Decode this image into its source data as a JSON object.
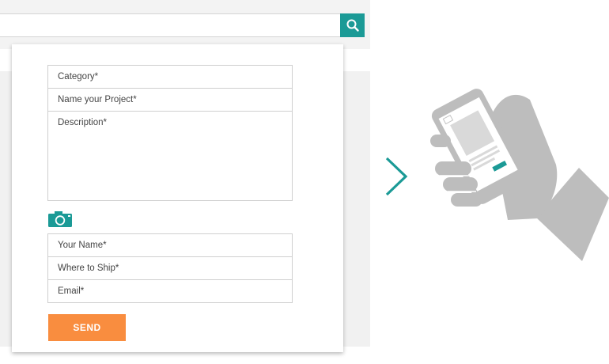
{
  "search": {
    "placeholder": "",
    "value": ""
  },
  "icons": {
    "search": "search-icon",
    "camera": "camera-icon",
    "arrow": "chevron-right-icon",
    "illustration": "hand-holding-phone-icon"
  },
  "form": {
    "category_label": "Category*",
    "project_label": "Name your Project*",
    "description_label": "Description*",
    "name_label": "Your Name*",
    "ship_label": "Where to Ship*",
    "email_label": "Email*",
    "send_label": "SEND"
  },
  "colors": {
    "accent_teal": "#1b9a96",
    "send_orange": "#f98d3f",
    "illustration_gray": "#bdbdbd"
  }
}
